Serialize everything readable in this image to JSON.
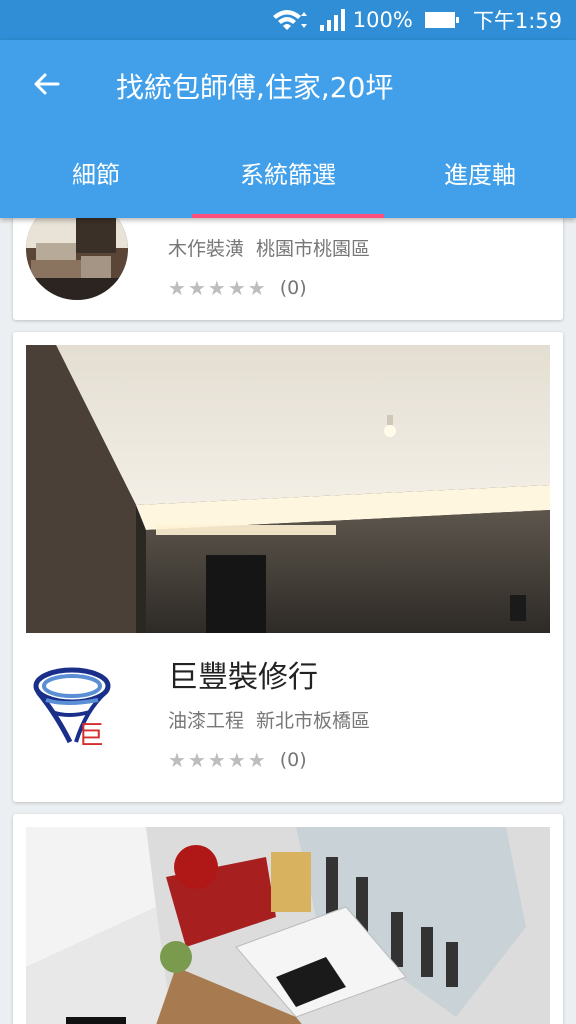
{
  "status_bar": {
    "battery_percent": "100%",
    "time": "下午1:59"
  },
  "app_bar": {
    "title": "找統包師傅,住家,20坪"
  },
  "tabs": [
    {
      "label": "細節",
      "selected": false
    },
    {
      "label": "系統篩選",
      "selected": true
    },
    {
      "label": "進度軸",
      "selected": false
    }
  ],
  "listings": [
    {
      "name": "",
      "category": "木作裝潢",
      "location": "桃園市桃園區",
      "rating": 0,
      "review_count": "(0)"
    },
    {
      "name": "巨豐裝修行",
      "category": "油漆工程",
      "location": "新北市板橋區",
      "rating": 0,
      "review_count": "(0)",
      "logo_text": "巨"
    },
    {
      "name": "",
      "category": "",
      "location": "",
      "rating": 0,
      "review_count": ""
    }
  ],
  "colors": {
    "status_bar": "#2f8ed6",
    "app_bar": "#42a0ea",
    "tab_indicator": "#ff4d7a"
  }
}
